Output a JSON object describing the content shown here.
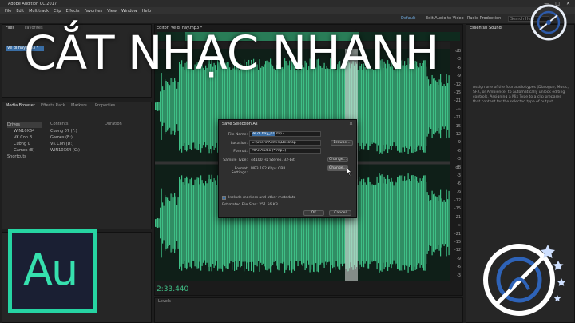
{
  "window": {
    "title": "Adobe Audition CC 2017",
    "controls": [
      "—",
      "□",
      "✕"
    ]
  },
  "menu": [
    "File",
    "Edit",
    "Multitrack",
    "Clip",
    "Effects",
    "Favorites",
    "View",
    "Window",
    "Help"
  ],
  "workspaces": {
    "default": "Default",
    "edit_audio_video": "Edit Audio to Video",
    "radio": "Radio Production",
    "search_placeholder": "Search Help"
  },
  "files_panel": {
    "tab_files": "Files",
    "tab_favorites": "Favorites",
    "selected_file": "Ve di hay.mp3 *"
  },
  "media_panel": {
    "tabs": [
      "Media Browser",
      "Effects Rack",
      "Markers",
      "Properties"
    ],
    "column_contents": "Contents:",
    "column_duration": "Duration",
    "drives_label": "Drives",
    "drives": [
      "WIN10X64",
      "VK Con B",
      "Cường 0",
      "Games (E)"
    ],
    "shortcuts_label": "Shortcuts",
    "contents": [
      "Cuong 07 (F:)",
      "Games (E:)",
      "VK Con (D:)",
      "WIN10X64 (C:)"
    ]
  },
  "editor": {
    "tab_label": "Editor: Ve di hay.mp3 *",
    "time": "2:33.440",
    "db_scale": [
      "dB",
      "-3",
      "-6",
      "-9",
      "-12",
      "-15",
      "-21",
      "-∞",
      "-21",
      "-15",
      "-12",
      "-9",
      "-6",
      "-3",
      "dB",
      "-3",
      "-6",
      "-9",
      "-12",
      "-15",
      "-21",
      "-∞",
      "-21",
      "-15",
      "-12",
      "-9",
      "-6",
      "-3"
    ],
    "bottom_tab": "Levels"
  },
  "overlay_title": "CẮT NHẠC NHANH",
  "essential_panel": {
    "title": "Essential Sound",
    "body": "Assign one of the four audio types (Dialogue, Music, SFX, or Ambience) to automatically unlock editing controls. Assigning a Mix Type to a clip prepares that content for the selected type of output."
  },
  "save_dialog": {
    "title": "Save Selection As",
    "file_name_label": "File Name:",
    "file_name_value": "Ve di hay_01",
    "file_name_ext": ".mp3",
    "location_label": "Location:",
    "location_value": "C:\\Users\\Admin\\Desktop",
    "browse_button": "Browse...",
    "format_label": "Format:",
    "format_value": "MP3 Audio (*.mp3)",
    "sample_type_label": "Sample Type:",
    "sample_type_value": "44100 Hz Stereo, 32-bit",
    "change_button_1": "Change...",
    "format_settings_label": "Format Settings:",
    "format_settings_value": "MP3 192 Kbps CBR",
    "change_button_2": "Change...",
    "include_markers_label": "Include markers and other metadata",
    "include_markers_checked": true,
    "estimated_size": "Estimated File Size: 251.56 KB",
    "ok_button": "OK",
    "cancel_button": "Cancel"
  },
  "logo": {
    "text": "Au",
    "accent": "#26d4a2",
    "bg": "#1a1f33"
  },
  "colors": {
    "waveform": "#3fbf86",
    "waveform_bg": "#123025",
    "selection": "#e6e6e6"
  }
}
